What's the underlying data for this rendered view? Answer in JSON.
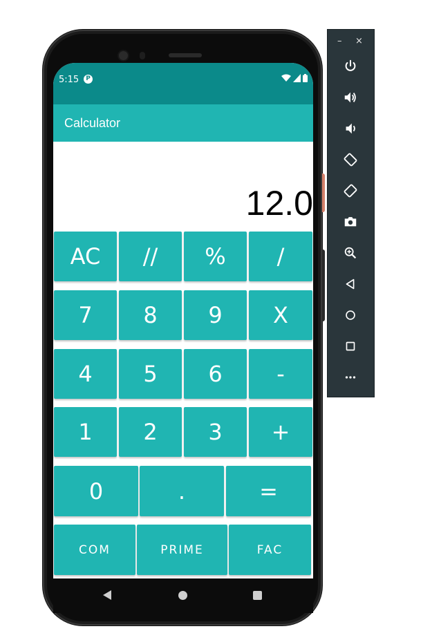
{
  "status_bar": {
    "time": "5:15",
    "indicator_letter": "P"
  },
  "app_bar": {
    "title": "Calculator"
  },
  "display": {
    "value": "12.0"
  },
  "keypad": {
    "row1": [
      "AC",
      "//",
      "%",
      "/"
    ],
    "row2": [
      "7",
      "8",
      "9",
      "X"
    ],
    "row3": [
      "4",
      "5",
      "6",
      "-"
    ],
    "row4": [
      "1",
      "2",
      "3",
      "+"
    ],
    "row5": [
      "0",
      ".",
      "="
    ],
    "row6": [
      "COM",
      "PRIME",
      "FAC"
    ]
  },
  "emulator_toolbar": {
    "minimize_glyph": "–",
    "close_glyph": "×",
    "icons": [
      "power-icon",
      "volume-up-icon",
      "volume-down-icon",
      "rotate-left-icon",
      "rotate-right-icon",
      "camera-icon",
      "zoom-icon",
      "back-icon",
      "home-icon",
      "overview-icon",
      "more-icon"
    ]
  },
  "colors": {
    "status_bar": "#0b8a8a",
    "accent": "#20b5b2",
    "toolbar": "#2a363b"
  }
}
